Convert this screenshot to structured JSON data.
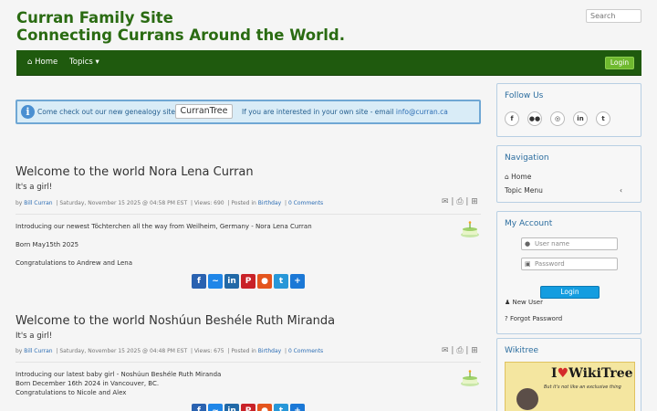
{
  "header": {
    "title_line1": "Curran Family Site",
    "title_line2": "Connecting Currans Around the World.",
    "search_placeholder": "Search"
  },
  "nav": {
    "home": "Home",
    "topics": "Topics",
    "login": "Login"
  },
  "notice": {
    "text1": "Come check out our new genealogy site.",
    "button": "CurranTree",
    "text2": "If you are interested in your own site - email",
    "email": "info@curran.ca"
  },
  "posts": [
    {
      "title": "Welcome to the world Nora Lena Curran",
      "subtitle": "It's a girl!",
      "meta": {
        "by": "by",
        "author": "Bill Curran",
        "date": "Saturday, November 15 2025 @ 04:58 PM EST",
        "views": "Views: 690",
        "posted_in": "Posted in",
        "category": "Birthday",
        "comments": "0 Comments"
      },
      "body": [
        "Introducing our newest Töchterchen all the way from Weilheim, Germany - Nora Lena Curran",
        "Born May15th 2025",
        "Congratulations to Andrew and Lena"
      ]
    },
    {
      "title": "Welcome to the world Noshúun Beshéle Ruth Miranda",
      "subtitle": "It's a girl!",
      "meta": {
        "by": "by",
        "author": "Bill Curran",
        "date": "Saturday, November 15 2025 @ 04:48 PM EST",
        "views": "Views: 675",
        "posted_in": "Posted in",
        "category": "Birthday",
        "comments": "0 Comments"
      },
      "body": [
        "Introducing our latest baby girl - Noshúun Beshéle Ruth Miranda",
        "Born December 16th 2024 in Vancouver, BC.",
        "Congratulations to Nicole and Alex"
      ]
    }
  ],
  "sidebar": {
    "follow_title": "Follow Us",
    "nav_title": "Navigation",
    "nav_home": "Home",
    "nav_topic_menu": "Topic Menu",
    "account_title": "My Account",
    "username_placeholder": "User name",
    "password_placeholder": "Password",
    "account_login": "Login",
    "new_user": "New User",
    "forgot_password": "Forgot Password",
    "wikitree_title": "Wikitree",
    "wiki_logo": "WikiTree",
    "wiki_tagline": "But it's not like an exclusive thing"
  },
  "colors": {
    "header_green": "#2a6b12",
    "navbar": "#1f5a0e",
    "link_blue": "#2c6db4",
    "login_blue": "#149de0"
  }
}
